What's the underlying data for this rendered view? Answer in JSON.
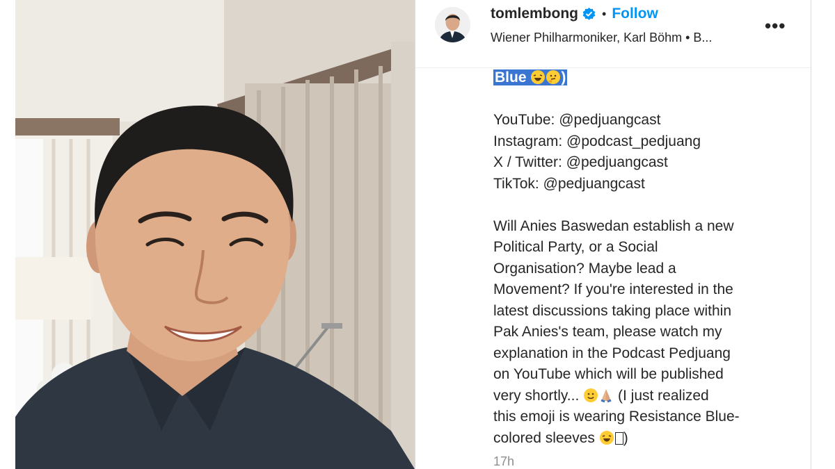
{
  "post": {
    "username": "tomlembong",
    "follow_label": "Follow",
    "separator": "•",
    "audio_line": "Wiener Philharmoniker, Karl Böhm • B...",
    "more_label": "•••",
    "timestamp": "17h"
  },
  "caption": {
    "selected_text": "Blue",
    "selected_suffix": ")",
    "youtube": "YouTube: @pedjuangcast",
    "instagram": "Instagram: @podcast_pedjuang",
    "twitter": "X / Twitter: @pedjuangcast",
    "tiktok": "TikTok: @pedjuangcast",
    "body_lines": [
      "Will Anies Baswedan establish a new",
      "Political Party, or a Social",
      "Organisation? Maybe lead a",
      "Movement? If you're interested in the",
      "latest discussions taking place within",
      "Pak Anies's team, please watch my",
      "explanation in the Podcast Pedjuang",
      "on YouTube which will be published"
    ],
    "line9_start": "very shortly...",
    "line9_end": "(I just realized",
    "line10": "this emoji is wearing Resistance Blue-",
    "line11_start": "colored sleeves",
    "line11_end": ")"
  },
  "colors": {
    "follow": "#0095f6",
    "verified": "#0095f6",
    "selection": "#3a76d1"
  }
}
